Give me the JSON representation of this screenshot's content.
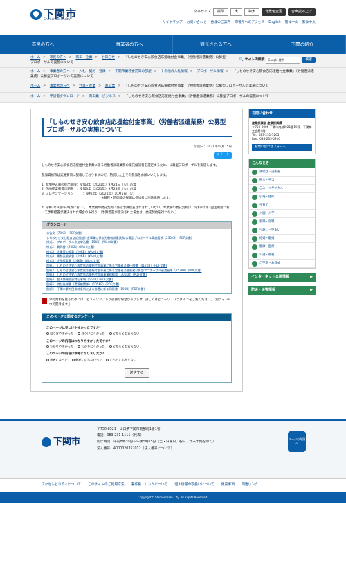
{
  "header": {
    "logo_name": "下関市",
    "logo_sub": "Shimonoseki-city",
    "font_label": "文字サイズ",
    "font_normal": "標準",
    "font_large": "大",
    "font_xlarge": "特大",
    "color_change": "背景色変更",
    "read_aloud": "音声読み上げ"
  },
  "header_links": [
    "サイトマップ",
    "お問い合わせ",
    "各課のご案内",
    "市役所へのアクセス",
    "English",
    "簡体中文",
    "繁体中文"
  ],
  "nav": [
    "市民の方へ",
    "事業者の方へ",
    "観光される方へ",
    "下関の紹介"
  ],
  "breadcrumbs": [
    {
      "items": [
        "ホーム",
        "市民の方へ",
        "商工・企業",
        "お知らせ"
      ],
      "current": "「しものせき安心飲食店応援給付金事業」（労働者派遣業務）公募型プロポーザルの実施について"
    },
    {
      "items": [
        "ホーム",
        "事業者の方へ",
        "入札・契約・登録",
        "下関市業務委託等の部屋",
        "その他の入札情報",
        "プロポーザル情報"
      ],
      "current": "「しものせき安心飲食店応援給付金事業」（労働者派遣業務）公募型プロポーザルの実施について"
    },
    {
      "items": [
        "ホーム",
        "事業者の方へ",
        "仕事・産業",
        "商工業"
      ],
      "current": "「しものせき安心飲食店応援給付金事業」（労働者派遣業務）公募型プロポーザルの実施について"
    },
    {
      "items": [
        "ホーム",
        "申請書ダウンロード",
        "商工業・ビジネス"
      ],
      "current": "「しものせき安心飲食店応援給付金事業」（労働者派遣業務）公募型プロポーザルの実施について"
    }
  ],
  "search": {
    "label": "サイト内検索",
    "placeholder": "Google 提供",
    "button": "検索"
  },
  "page": {
    "title": "「しものせき安心飲食店応援給付金事業」（労働者派遣業務）公募型プロポーザルの実施について",
    "published": "公開日：2021年09月15日",
    "tweet": "ツイート",
    "intro": "しものせき安心飲食店応援給付金事業に係る労働者派遣業務の受託候補者を選定するため、公募型プロポーザルを実施します。",
    "intro2": "参加資格等は実施要領に記載しておりますので、熟読した上での参加をお願いいたします。",
    "schedule": [
      "1. 参加申込書の提出期限：令和3年（2021年）9月21日（火）必着",
      "2. 企画提案書提出期限　：令和3年（2021年）9月28日（火）必着",
      "3. プレゼンテーション　　　：令和3年（2021年）10月5日（火）",
      "※日程・時間等の詳細は参加者に別途連絡します。"
    ],
    "note4": "4. 令和3年9月1日時点において、本業務の委託契約に係る予算措置はなされていない。本業務の委託契約は、令和3年第2回定例会において予算措置が議決された場合のみ行う。（予算措置が否決された場合は、委託契約を行わない。）"
  },
  "download": {
    "heading": "ダウンロード",
    "files": [
      "公告文（70KB）(PDF文書)",
      "しものせき安心飲食店応援給付金事業に係る労働者派遣業務 公募型プロポーザル実施要領（230KB）(PDF文書)",
      "様式1　プロポーザル参加申込書（15KB）(Word文書)",
      "様式2　質問書（20KB）(Word文書)",
      "様式3　企業等の概要（20KB）(Word文書)",
      "様式4　業務実績調書（20KB）(Word文書)",
      "様式5　企画提案書（24KB）(Word文書)",
      "別紙1　しものせき安心飲食店応援給付金事業に係る労働者派遣仕様書（412KB）(PDF文書)",
      "別紙2　しものせき安心飲食店応援給付金事業に係る労働者派遣業務公募型プロポーザル審査基準（153KB）(PDF文書)",
      "別紙3　しものせき安心飲食店応援給付金事業業務概要（301KB）(PDF文書)",
      "別紙4　個人情報取扱特記事項（56KB）(PDF文書)",
      "別紙5　特記仕様書（環境編関係）（105KB）(PDF文書)",
      "別紙6　下関市暴力団排除条例による措置に係る同意書（19KB）(PDF文書)"
    ]
  },
  "reader_note": "添付資料を見るためには、ビューワソフトが必要な場合があります。詳しくはビューワ・プラグインをご覧ください。（別ウィンドウで開きます。）",
  "survey": {
    "heading": "このページに関するアンケート",
    "q1": "このページは見つけやすかったですか？",
    "q1o": [
      "見つけやすかった",
      "見つけにくかった",
      "どちらとも言えない"
    ],
    "q2": "このページの内容はわかりやすかったですか？",
    "q2o": [
      "わかりやすかった",
      "わかりにくかった",
      "どちらとも言えない"
    ],
    "q3": "このページの内容は参考になりましたか？",
    "q3o": [
      "参考になった",
      "参考にならなかった",
      "どちらとも言えない"
    ],
    "send": "送信する"
  },
  "side": {
    "contact_h": "お問い合わせ",
    "dept": "産業振興部 産業振興課",
    "addr": "〒750-0006 下関市南部町21番19号　下関商工会館4階",
    "tel": "Tel：083-231-1265",
    "fax": "Fax：083-235-0910",
    "form": "お問い合わせフォーム",
    "konna_h": "こんなとき",
    "konna": [
      "手続き・証明書",
      "税金・手当",
      "ごみ・リサイクル",
      "引越・住所",
      "子育て",
      "入園・入学",
      "就職・退職",
      "引越し・住まい",
      "結婚・離婚",
      "健康・医療",
      "介護・福祉",
      "ご不幸・お葬式"
    ],
    "internet": "インターネット公開情報",
    "bousai": "防災・災害情報"
  },
  "footer": {
    "logo": "下関市",
    "addr": "〒750-8521　山口県下関市南部町1番1号",
    "tel": "電話：083-231-1111（代表）",
    "hours": "開庁時間：午前8時30分〜午後5時15分（土・日曜日、祝日、年末年始を除く）",
    "corp": "法人番号：4000020352012（法人番号について）",
    "pagetop": "ページの先頭へ",
    "links": [
      "アクセシビリティについて",
      "このサイトのご利用方法",
      "著作権・リンクについて",
      "個人情報の取扱いについて",
      "免責事項",
      "関連リンク"
    ],
    "copyright": "Copyright© Shimonoseki City. All Rights Reserved."
  }
}
